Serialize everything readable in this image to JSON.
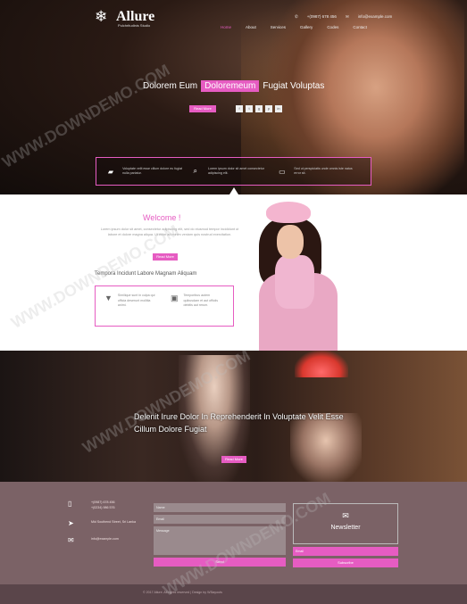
{
  "header": {
    "brand": "Allure",
    "brand_sub": "Pulchritudinis Studio",
    "phone": "+(0987) 678 456",
    "email": "info@example.com",
    "nav": [
      "Home",
      "About",
      "Services",
      "Gallery",
      "Codes",
      "Contact"
    ],
    "hero_title_before": "Dolorem Eum",
    "hero_title_highlight": "Doloremeum",
    "hero_title_after": "Fugiat Voluptas",
    "hero_button": "Read More",
    "socials": [
      "f",
      "t",
      "g",
      "p",
      "in"
    ],
    "features": [
      {
        "icon": "folder-icon",
        "text": "Voluptate velit esse cillum dolore eu fugiat nulla pariatur."
      },
      {
        "icon": "search-icon",
        "text": "Lorem ipsum dolor sit amet consectetur adipiscing elit."
      },
      {
        "icon": "monitor-icon",
        "text": "Sed ut perspiciatis unde omnis iste natus error sit."
      }
    ]
  },
  "welcome": {
    "title": "Welcome !",
    "text": "Lorem ipsum dolor sit amet, consectetur adipiscing elit, sed do eiusmod tempor incididunt ut labore et dolore magna aliqua. Ut enim ad minim veniam quis nostrud exercitation.",
    "button": "Read More",
    "subtitle": "Tempora Incidunt Labore Magnam Aliquam",
    "items": [
      {
        "icon": "filter-icon",
        "text": "Similique sunt in culpa qui officia deserunt mollitia animi."
      },
      {
        "icon": "image-icon",
        "text": "Temporibus autem quibusdam et aut officiis debitis aut rerum."
      }
    ]
  },
  "band": {
    "text": "Delenit Irure Dolor In Reprehenderit In Voluptate Velit Esse Cillum Dolore Fugiat",
    "button": "Read More"
  },
  "contact": {
    "phones": [
      "+(0987) 678 456",
      "+(0234) 986 576"
    ],
    "address": "Mid Southend Street, Sri Lanka",
    "email": "info@example.com",
    "form": {
      "name": "Name",
      "email": "Email",
      "message": "Message",
      "submit": "Send"
    },
    "newsletter": {
      "title": "Newsletter",
      "placeholder": "Email",
      "button": "Subscribe"
    }
  },
  "footer": {
    "text": "© 2017 Allure. All rights reserved | Design by W3layouts"
  },
  "watermark": "WWW.DOWNDEMO.COM",
  "colors": {
    "accent": "#e65cc2",
    "contact_bg": "#7b6266",
    "footer_bg": "#5a454a"
  }
}
